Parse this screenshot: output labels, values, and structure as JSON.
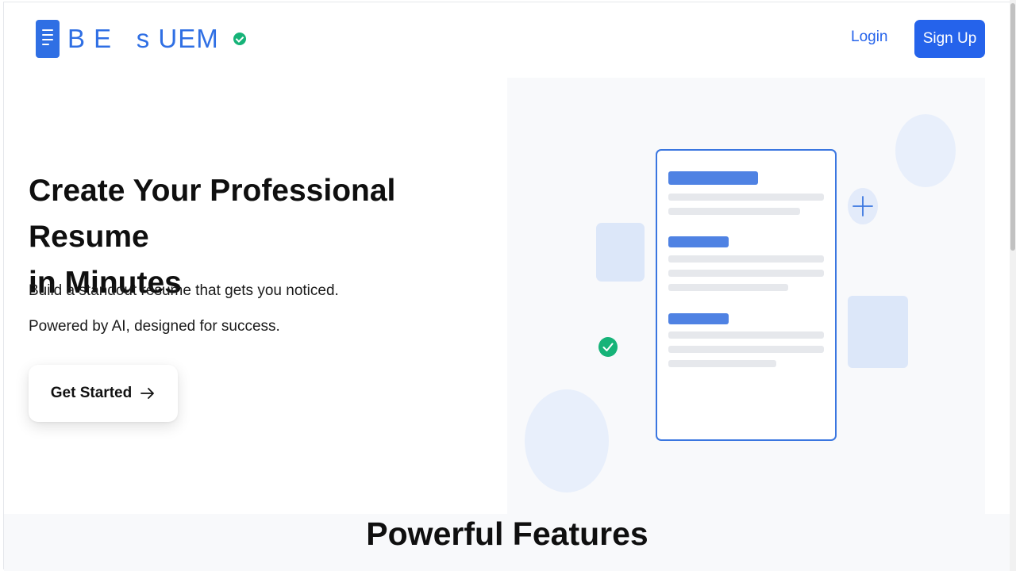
{
  "header": {
    "brand_name": "B E   s UEM",
    "login_label": "Login",
    "signup_label": "Sign Up"
  },
  "hero": {
    "title_line1": "Create Your Professional Resume",
    "title_line2": "in Minutes",
    "subtitle_1": "Build a standout resume that gets you noticed.",
    "subtitle_2": "Powered by AI, designed for success.",
    "cta_label": "Get Started"
  },
  "features": {
    "heading": "Powerful Features"
  },
  "icons": {
    "brand": "document-icon",
    "verified": "check-circle-icon",
    "cta": "arrow-right-icon",
    "illustration_plus": "plus-icon",
    "illustration_check": "check-circle-icon"
  },
  "colors": {
    "primary": "#2563eb",
    "brand": "#2f6fe4",
    "success": "#16b378",
    "illustration_bg": "#f8f9fb",
    "features_bg": "#f8f9fb"
  }
}
